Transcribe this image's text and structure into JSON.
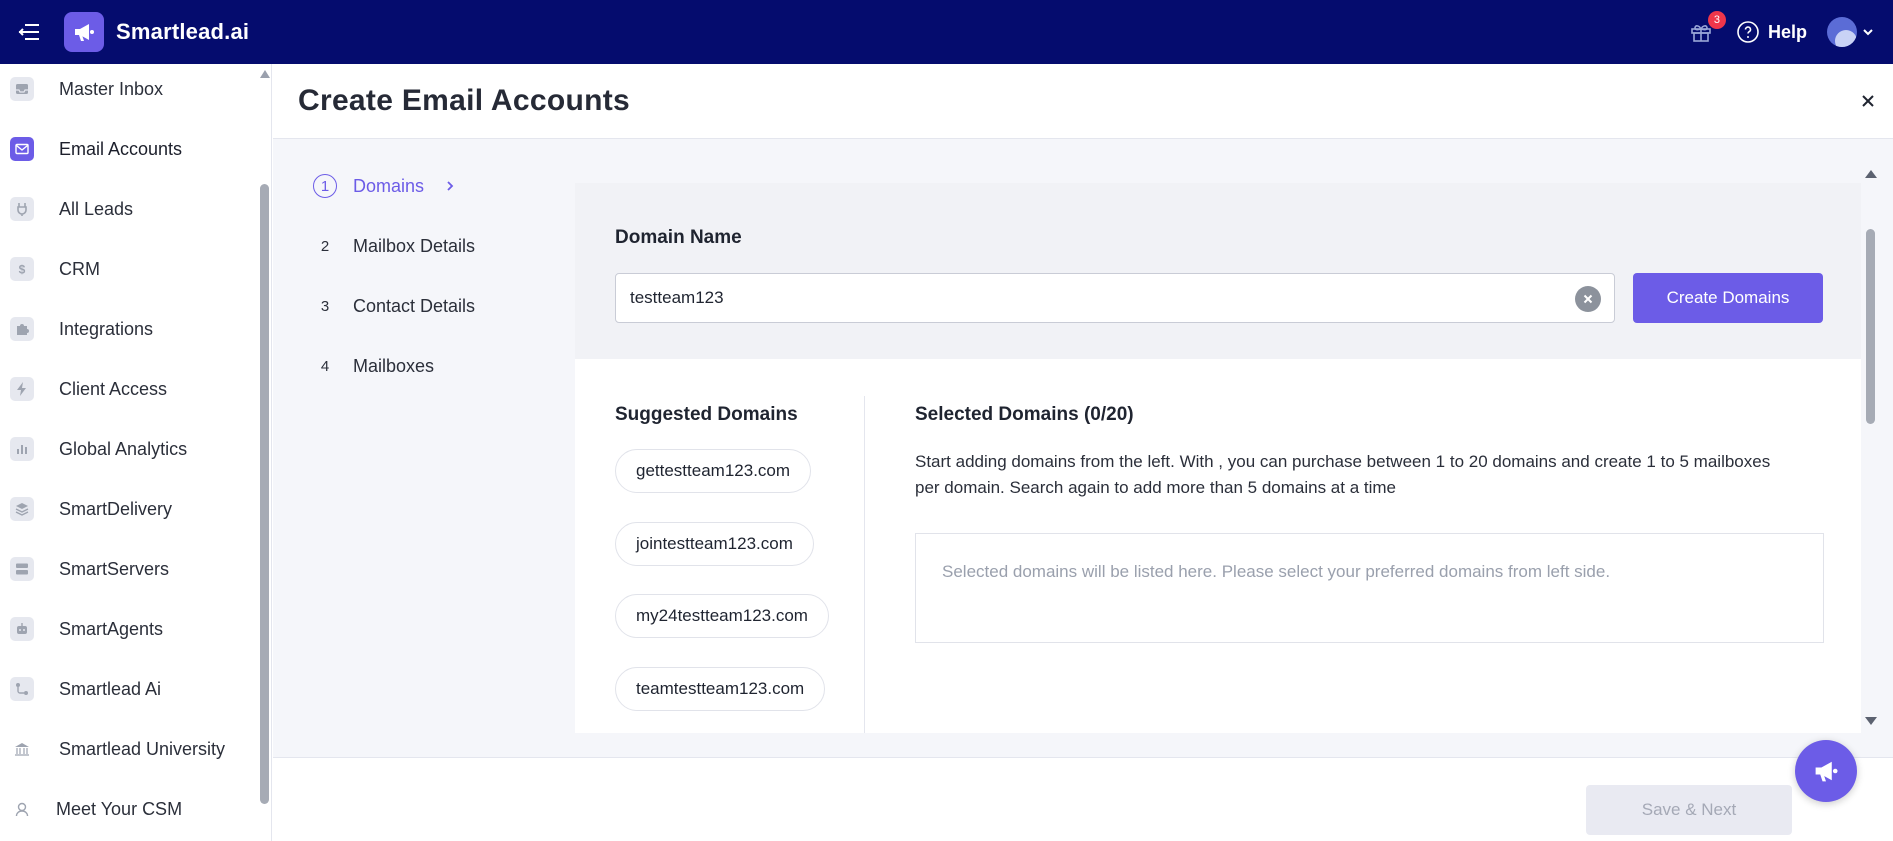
{
  "topbar": {
    "brand": "Smartlead.ai",
    "notifications_count": "3",
    "help_label": "Help",
    "icons": [
      "hamburger-menu-icon",
      "logo-megaphone-icon",
      "gift-icon",
      "help-icon",
      "avatar",
      "chevron-down-icon"
    ]
  },
  "sidebar": {
    "items": [
      {
        "label": "Master Inbox",
        "icon": "inbox-icon"
      },
      {
        "label": "Email Accounts",
        "icon": "mail-icon",
        "active": true
      },
      {
        "label": "All Leads",
        "icon": "plug-icon"
      },
      {
        "label": "CRM",
        "icon": "dollar-icon"
      },
      {
        "label": "Integrations",
        "icon": "puzzle-icon"
      },
      {
        "label": "Client Access",
        "icon": "bolt-icon"
      },
      {
        "label": "Global Analytics",
        "icon": "bar-chart-icon"
      },
      {
        "label": "SmartDelivery",
        "icon": "layers-icon"
      },
      {
        "label": "SmartServers",
        "icon": "server-icon"
      },
      {
        "label": "SmartAgents",
        "icon": "robot-icon"
      },
      {
        "label": "Smartlead Ai",
        "icon": "flow-icon"
      },
      {
        "label": "Smartlead University",
        "icon": "university-icon"
      },
      {
        "label": "Meet Your CSM",
        "icon": "headset-icon"
      }
    ]
  },
  "page": {
    "title": "Create Email Accounts"
  },
  "steps": [
    {
      "num": "1",
      "label": "Domains",
      "active": true
    },
    {
      "num": "2",
      "label": "Mailbox Details"
    },
    {
      "num": "3",
      "label": "Contact Details"
    },
    {
      "num": "4",
      "label": "Mailboxes"
    }
  ],
  "domain": {
    "label": "Domain Name",
    "value": "testteam123",
    "create_button": "Create Domains"
  },
  "suggested": {
    "title": "Suggested Domains",
    "items": [
      "gettestteam123.com",
      "jointestteam123.com",
      "my24testteam123.com",
      "teamtestteam123.com"
    ]
  },
  "selected": {
    "title": "Selected Domains (0/20)",
    "description": "Start adding domains from the left. With , you can purchase between 1 to 20 domains and create 1 to 5 mailboxes per domain. Search again to add more than 5 domains at a time",
    "placeholder": "Selected domains will be listed here. Please select your preferred domains from left side."
  },
  "footer": {
    "save_button": "Save & Next"
  },
  "colors": {
    "topbar": "#050c6e",
    "accent": "#6c5ce7",
    "badge": "#f0364b"
  }
}
